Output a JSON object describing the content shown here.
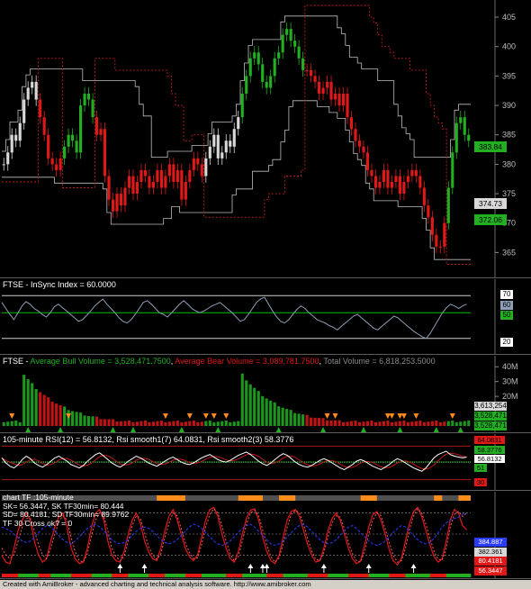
{
  "colors": {
    "background": "#000000",
    "bull": "#22b022",
    "bear": "#e01818",
    "neutral": "#d8d8d8",
    "axis_text": "#bdbdbd",
    "grid_sep": "#555555",
    "white": "#ffffff",
    "rsi_line": "#8f9fb8",
    "orange": "#ff8c1a",
    "blue": "#2a3cff",
    "green_line": "#00c000"
  },
  "panes": {
    "price": {
      "badges": {
        "last_close": "383.84",
        "level_grey": "374.73",
        "level_green": "372.06"
      }
    },
    "insync": {
      "title": "FTSE - InSync Index = 60.0000",
      "badges": {
        "upper": "70",
        "value": "60",
        "mid": "50",
        "lower": "20"
      }
    },
    "volume": {
      "title_prefix": "FTSE - ",
      "title_bull": "Average Bull Volume = 3,528,471.7500",
      "title_bear": "Average Bear Volume = 3,089,781.7500",
      "title_total": "Total Volume = 6,818,253.5000",
      "badges": {
        "grey": "3,613,254",
        "bull": "3,528,471",
        "bear": "3,528,471"
      }
    },
    "rsi": {
      "title": "105-minute RSI(12) = 56.8132, Rsi smooth1(7) 64.0831, Rsi smooth2(3) 58.3776",
      "badges": {
        "top": "64.0831",
        "green": "58.3776",
        "white": "56.8132",
        "grn_small": "51",
        "red_small": "30"
      }
    },
    "stoch": {
      "title_lines": [
        "chart TF :105-minute",
        "SK= 56.3447,  SK TF30min= 80.444",
        "SD= 80.4181,  SD TF30min= 89.9762",
        "TF 30 Cross ok? = 0"
      ],
      "badges": {
        "blue": "384.887",
        "grey": "382.361",
        "red1": "80.4181",
        "red2": "56.3447"
      }
    }
  },
  "footer": "Created with AmiBroker - advanced charting and technical analysis software. http://www.amibroker.com",
  "chart_data": [
    {
      "type": "candlestick",
      "title": "",
      "ylim": [
        362,
        407
      ],
      "yticks": [
        365,
        370,
        375,
        380,
        385,
        390,
        395,
        400,
        405
      ],
      "closes": [
        380,
        382,
        385,
        384,
        387,
        391,
        393,
        394,
        391,
        388,
        385,
        381,
        380,
        379,
        381,
        383,
        385,
        384,
        382,
        390,
        392,
        391,
        388,
        385,
        386,
        378,
        374,
        372,
        375,
        373,
        376,
        378,
        375,
        377,
        379,
        378,
        376,
        377,
        379,
        376,
        378,
        380,
        377,
        379,
        374,
        377,
        379,
        381,
        380,
        378,
        381,
        383,
        385,
        381,
        382,
        384,
        383,
        386,
        388,
        392,
        395,
        398,
        399,
        397,
        394,
        393,
        395,
        398,
        399,
        402,
        403,
        401,
        400,
        398,
        396,
        396,
        395,
        394,
        392,
        393,
        394,
        391,
        392,
        390,
        392,
        388,
        386,
        384,
        383,
        382,
        379,
        378,
        376,
        377,
        379,
        376,
        377,
        378,
        375,
        377,
        378,
        379,
        378,
        376,
        373,
        371,
        368,
        366,
        366,
        370,
        376,
        382,
        387,
        388,
        385,
        384
      ],
      "colors_by_bar": [
        "neutral",
        "neutral",
        "neutral",
        "neutral",
        "neutral",
        "neutral",
        "neutral",
        "neutral",
        "neutral",
        "bear",
        "bear",
        "bear",
        "bear",
        "bear",
        "bear",
        "bull",
        "bull",
        "bull",
        "bull",
        "bull",
        "bull",
        "bull",
        "bull",
        "bear",
        "bear",
        "bear",
        "bear",
        "bear",
        "bear",
        "bear",
        "bear",
        "bear",
        "bear",
        "bear",
        "bear",
        "bear",
        "bear",
        "bear",
        "bear",
        "bear",
        "bear",
        "bear",
        "bear",
        "bear",
        "bear",
        "bear",
        "bear",
        "bear",
        "bear",
        "bear",
        "neutral",
        "neutral",
        "neutral",
        "neutral",
        "neutral",
        "neutral",
        "neutral",
        "neutral",
        "neutral",
        "bull",
        "bull",
        "bull",
        "bull",
        "bull",
        "bull",
        "bull",
        "bull",
        "bull",
        "bull",
        "bull",
        "bull",
        "bull",
        "bull",
        "bull",
        "bull",
        "bear",
        "bear",
        "bear",
        "bear",
        "bear",
        "bear",
        "bear",
        "bear",
        "bear",
        "bear",
        "bear",
        "bear",
        "bear",
        "bear",
        "bear",
        "bear",
        "bear",
        "bear",
        "bear",
        "bear",
        "bear",
        "bear",
        "bear",
        "bear",
        "bear",
        "bear",
        "bear",
        "bear",
        "bear",
        "bear",
        "bear",
        "bear",
        "bear",
        "bear",
        "bear",
        "bull",
        "bull",
        "bull",
        "bull",
        "bull",
        "bull"
      ]
    },
    {
      "type": "line",
      "title": "FTSE - InSync Index",
      "ylim": [
        5,
        85
      ],
      "levels": [
        70,
        50,
        20
      ],
      "values": [
        62,
        55,
        48,
        42,
        50,
        58,
        63,
        60,
        55,
        52,
        48,
        45,
        50,
        57,
        60,
        56,
        52,
        48,
        44,
        40,
        42,
        47,
        52,
        58,
        62,
        66,
        60,
        55,
        50,
        44,
        40,
        38,
        42,
        48,
        55,
        62,
        64,
        60,
        55,
        50,
        48,
        45,
        50,
        55,
        60,
        64,
        60,
        55,
        52,
        50,
        52,
        55,
        58,
        60,
        62,
        58,
        54,
        50,
        45,
        40,
        42,
        48,
        55,
        62,
        66,
        68,
        60,
        52,
        45,
        40,
        38,
        42,
        48,
        54,
        58,
        55,
        50,
        46,
        42,
        40,
        38,
        35,
        33,
        30,
        34,
        38,
        42,
        46,
        48,
        44,
        40,
        36,
        32,
        30,
        34,
        38,
        42,
        46,
        44,
        40,
        36,
        32,
        28,
        25,
        22,
        20,
        26,
        34,
        42,
        50,
        56,
        60,
        58,
        55,
        58,
        60
      ]
    },
    {
      "type": "bar",
      "title": "FTSE - Volume",
      "ylim": [
        0,
        45
      ],
      "ytick_labels": [
        "40M",
        "30M",
        "20M"
      ],
      "yticks": [
        40,
        30,
        20
      ],
      "series": [
        {
          "name": "Average Bull Volume",
          "value": 3528471.75
        },
        {
          "name": "Average Bear Volume",
          "value": 3089781.75
        },
        {
          "name": "Total Volume",
          "value": 6818253.5
        }
      ]
    },
    {
      "type": "line",
      "title": "105-minute RSI(12)",
      "ylim": [
        20,
        80
      ],
      "values": [
        56,
        50,
        46,
        44,
        48,
        54,
        58,
        55,
        50,
        47,
        45,
        48,
        52,
        56,
        58,
        55,
        52,
        48,
        46,
        44,
        47,
        52,
        56,
        60,
        62,
        58,
        54,
        50,
        47,
        45,
        48,
        52,
        55,
        58,
        56,
        53,
        50,
        48,
        46,
        49,
        52,
        55,
        57,
        54,
        51,
        49,
        48,
        50,
        53,
        56,
        58,
        60,
        57,
        54,
        52,
        51,
        53,
        56,
        59,
        61,
        63,
        60,
        56,
        52,
        49,
        47,
        50,
        54,
        58,
        61,
        59,
        55,
        51,
        48,
        46,
        45,
        47,
        50,
        53,
        55,
        53,
        50,
        47,
        44,
        42,
        45,
        48,
        52,
        54,
        52,
        49,
        46,
        44,
        42,
        45,
        48,
        52,
        55,
        53,
        50,
        47,
        44,
        42,
        40,
        44,
        50,
        56,
        60,
        62,
        64,
        60,
        58,
        57,
        56,
        57
      ]
    },
    {
      "type": "line",
      "title": "chart TF :105-minute",
      "ylim": [
        0,
        100
      ],
      "series": [
        {
          "name": "SK",
          "values": [
            20,
            10,
            8,
            30,
            55,
            70,
            80,
            70,
            40,
            20,
            10,
            15,
            40,
            60,
            75,
            80,
            60,
            30,
            15,
            8,
            10,
            30,
            60,
            80,
            85,
            70,
            40,
            20,
            12,
            10,
            25,
            50,
            70,
            80,
            65,
            40,
            25,
            15,
            12,
            30,
            55,
            75,
            85,
            70,
            50,
            30,
            18,
            12,
            20,
            45,
            70,
            85,
            88,
            75,
            50,
            30,
            15,
            10,
            25,
            50,
            72,
            84,
            86,
            70,
            45,
            25,
            12,
            8,
            20,
            45,
            70,
            82,
            85,
            75,
            55,
            35,
            20,
            10,
            12,
            30,
            55,
            72,
            80,
            70,
            50,
            30,
            15,
            8,
            12,
            35,
            60,
            78,
            82,
            70,
            50,
            28,
            12,
            6,
            15,
            40,
            65,
            82,
            88,
            75,
            55,
            35,
            18,
            10,
            15,
            40,
            70,
            85,
            80,
            62,
            56
          ]
        },
        {
          "name": "SD",
          "values": [
            30,
            20,
            15,
            20,
            40,
            60,
            72,
            72,
            55,
            35,
            20,
            15,
            30,
            50,
            68,
            76,
            70,
            45,
            25,
            12,
            10,
            22,
            48,
            70,
            80,
            76,
            55,
            30,
            18,
            12,
            18,
            40,
            62,
            76,
            72,
            52,
            32,
            20,
            14,
            22,
            45,
            65,
            80,
            76,
            58,
            38,
            24,
            15,
            16,
            35,
            60,
            78,
            86,
            80,
            62,
            40,
            22,
            12,
            18,
            40,
            64,
            80,
            84,
            76,
            56,
            34,
            18,
            10,
            16,
            36,
            60,
            78,
            84,
            80,
            64,
            44,
            26,
            14,
            12,
            24,
            46,
            66,
            76,
            74,
            58,
            38,
            22,
            12,
            10,
            26,
            50,
            70,
            80,
            76,
            58,
            38,
            20,
            10,
            12,
            30,
            56,
            76,
            86,
            80,
            64,
            44,
            26,
            14,
            13,
            30,
            60,
            78,
            82,
            75,
            80
          ]
        },
        {
          "name": "SK TF30min",
          "values": [
            60,
            58,
            55,
            50,
            45,
            40,
            38,
            40,
            45,
            52,
            58,
            62,
            60,
            55,
            48,
            42,
            38,
            36,
            40,
            46,
            52,
            58,
            62,
            64,
            60,
            55,
            48,
            42,
            38,
            36,
            38,
            42,
            48,
            54,
            58,
            60,
            58,
            54,
            48,
            42,
            38,
            36,
            38,
            42,
            48,
            54,
            60,
            64,
            62,
            58,
            52,
            46,
            40,
            36,
            34,
            36,
            40,
            46,
            52,
            58,
            62,
            64,
            60,
            54,
            48,
            42,
            36,
            34,
            36,
            40,
            46,
            52,
            58,
            62,
            64,
            60,
            54,
            48,
            42,
            38,
            36,
            38,
            42,
            48,
            54,
            60,
            62,
            58,
            52,
            46,
            40,
            36,
            34,
            36,
            40,
            46,
            52,
            58,
            62,
            60,
            54,
            48,
            42,
            38,
            36,
            38,
            44,
            52,
            60,
            66,
            70,
            72,
            74,
            78,
            80
          ]
        }
      ]
    }
  ]
}
